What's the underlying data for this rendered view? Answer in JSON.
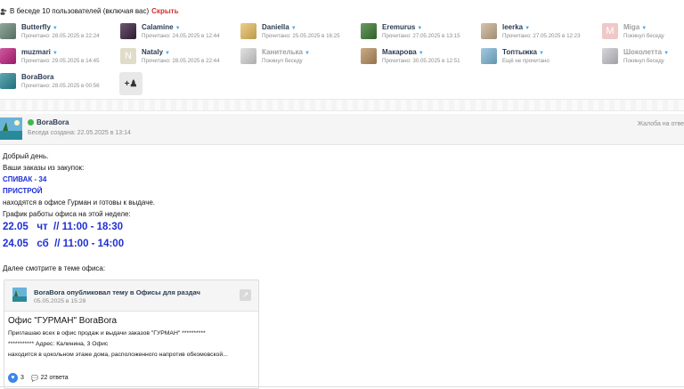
{
  "header": {
    "text": "В беседе 10 пользователей (включая вас)",
    "hide": "Скрыть"
  },
  "participants": [
    {
      "name": "Butterfly",
      "status": "Прочитано: 28.05.2025 в 22:24",
      "color": "#6b8a7a",
      "caret": true,
      "dim": false
    },
    {
      "name": "Calamine",
      "status": "Прочитано: 24.05.2025 в 12:44",
      "color": "#3a2040",
      "caret": true,
      "dim": false
    },
    {
      "name": "Daniella",
      "status": "Прочитано: 25.05.2025 в 16:25",
      "color": "#e8c060",
      "caret": true,
      "dim": false
    },
    {
      "name": "Eremurus",
      "status": "Прочитано: 27.05.2025 в 13:15",
      "color": "#3a7a30",
      "caret": true,
      "dim": false
    },
    {
      "name": "leerka",
      "status": "Прочитано: 27.05.2025 в 12:23",
      "color": "#c8b090",
      "caret": true,
      "dim": false
    },
    {
      "name": "Miga",
      "status": "Покинул беседу",
      "color": "#f0c8c8",
      "letter": "M",
      "caret": true,
      "dim": true
    },
    {
      "name": "muzmari",
      "status": "Прочитано: 29.05.2025 в 14:45",
      "color": "#c02080",
      "caret": true,
      "dim": false
    },
    {
      "name": "Nataly",
      "status": "Прочитано: 28.05.2025 в 22:44",
      "color": "#e0dcc8",
      "letter": "N",
      "caret": true,
      "dim": false
    },
    {
      "name": "Канителька",
      "status": "Покинул беседу",
      "color": "#d8d8d8",
      "caret": true,
      "dim": true
    },
    {
      "name": "Макарова",
      "status": "Прочитано: 30.05.2025 в 12:51",
      "color": "#b89060",
      "caret": true,
      "dim": false
    },
    {
      "name": "Топтыжка",
      "status": "Ещё не прочитано",
      "color": "#80b8d8",
      "caret": true,
      "dim": false
    },
    {
      "name": "Шоколетта",
      "status": "Покинул беседу",
      "color": "#c8c8d0",
      "caret": true,
      "dim": true
    },
    {
      "name": "BoraBora",
      "status": "Прочитано: 28.05.2025 в 00:56",
      "color": "#2a8a9a",
      "caret": false,
      "dim": false
    }
  ],
  "add_button": {
    "label": "+♟"
  },
  "message": {
    "author": "BoraBora",
    "created": "Беседа создана: 22.05.2025 в 13:14",
    "report": "Жалоба на отве",
    "lines": {
      "l1": "Добрый день.",
      "l2": "Ваши заказы из закупок:",
      "l3": "СПИВАК - 34",
      "l4": "ПРИСТРОЙ",
      "l5": "находятся в офисе Гурман и готовы к выдаче.",
      "l6": "График работы офиса на этой неделе:",
      "l7": "22.05   чт  // 11:00 - 18:30",
      "l8": "24.05   сб  // 11:00 - 14:00",
      "l9": "Далее смотрите в теме офиса:"
    }
  },
  "card": {
    "publisher": "BoraBora опубликовал тему в Офисы для раздач",
    "date": "05.05.2025 в 15:28",
    "title": "Офис \"ГУРМАН\" BoraBora",
    "text1": "Приглашаю всех в офис продаж и выдачи заказов  \"ГУРМАН\"   **********",
    "text2": "*********** Адрес: Калинина, 3 Офис",
    "text3": "находится в цокольном этаже дома, расположенного напротив обкомовской...",
    "likes": "3",
    "replies": "22 ответа"
  }
}
